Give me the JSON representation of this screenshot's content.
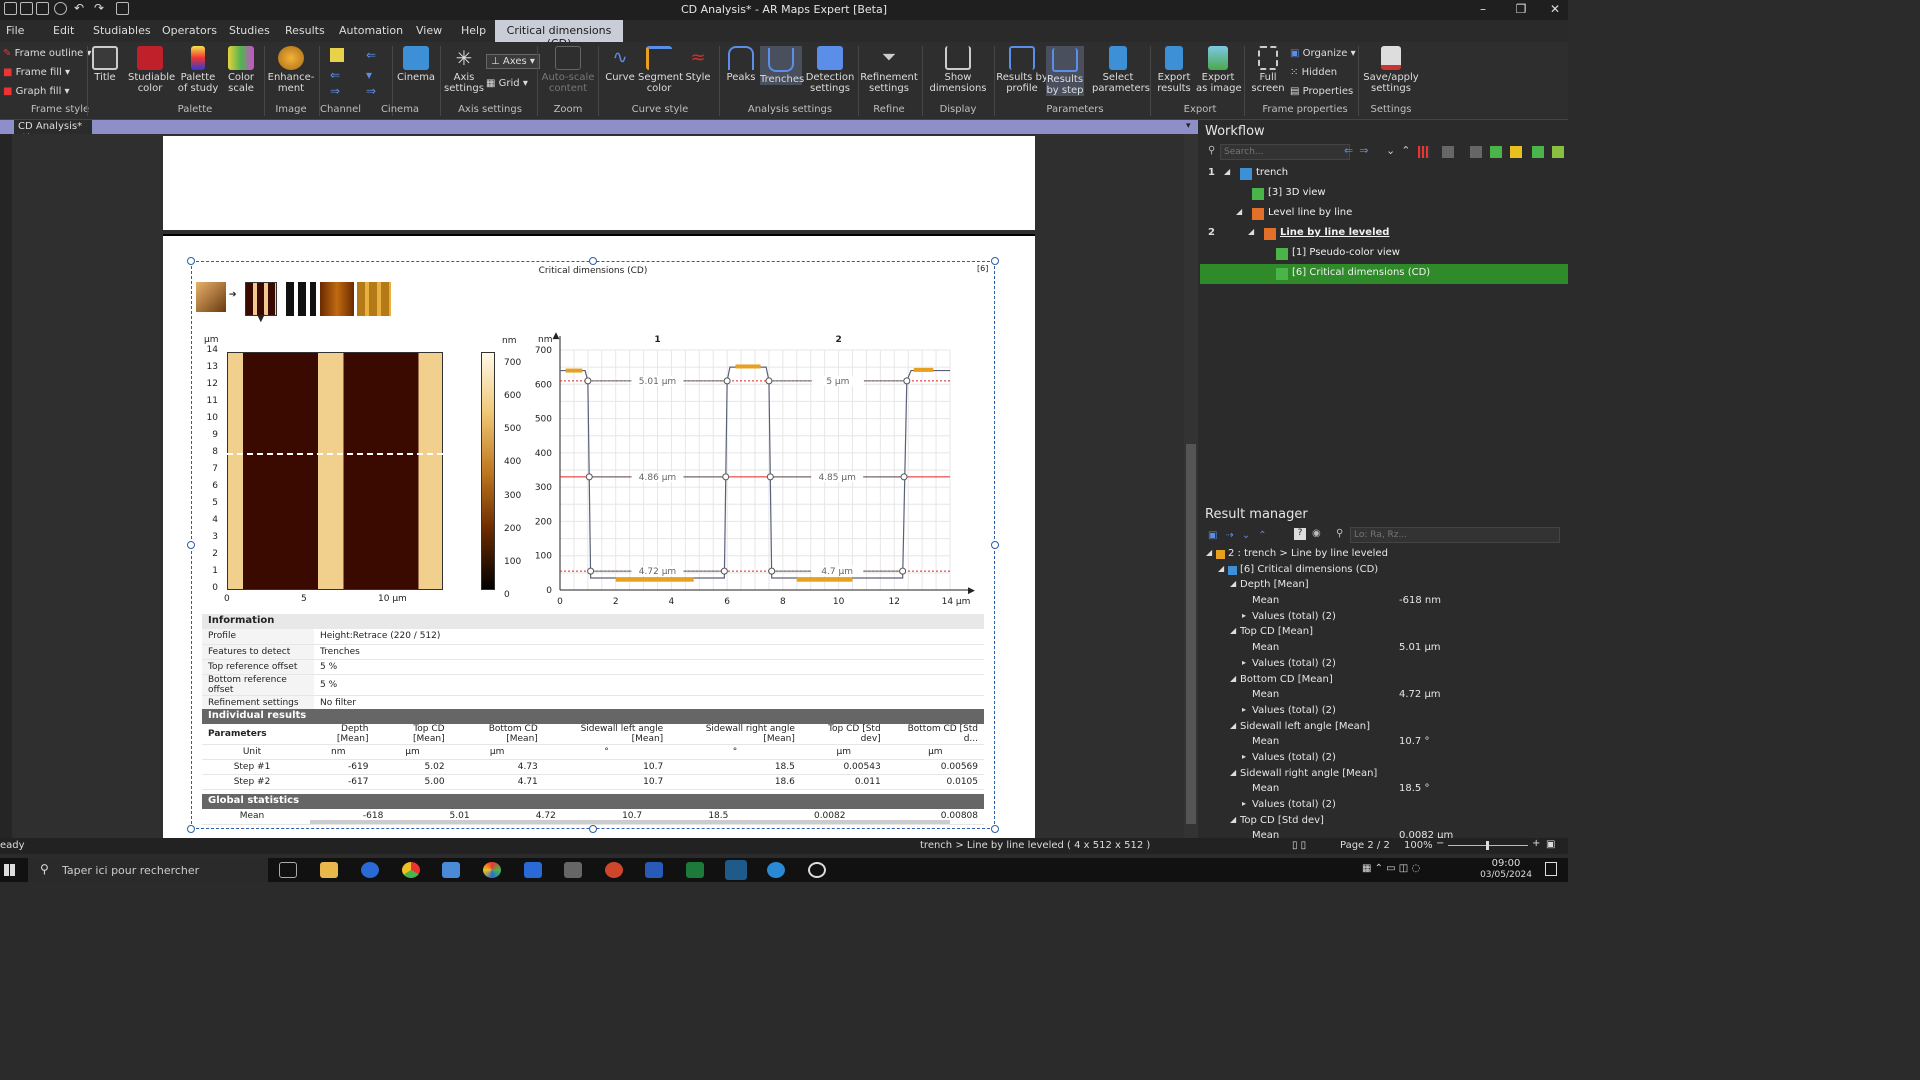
{
  "app": {
    "title": "CD Analysis* - AR Maps Expert [Beta]"
  },
  "menu": [
    "File",
    "Edit",
    "Studiables",
    "Operators",
    "Studies",
    "Results",
    "Automation",
    "View",
    "Help"
  ],
  "context_tab": "Critical dimensions (CD)",
  "ribbon": {
    "frame_style": [
      "Frame outline",
      "Frame fill",
      "Graph fill"
    ],
    "buttons": [
      {
        "id": "title",
        "label": "Title"
      },
      {
        "id": "studiable-color",
        "label": "Studiable\ncolor"
      },
      {
        "id": "palette-of-study",
        "label": "Palette\nof study"
      },
      {
        "id": "color-scale",
        "label": "Color\nscale"
      },
      {
        "id": "enhancement",
        "label": "Enhance-\nment"
      },
      {
        "id": "cinema",
        "label": "Cinema"
      },
      {
        "id": "axis-settings",
        "label": "Axis\nsettings"
      },
      {
        "id": "auto-scale",
        "label": "Auto-scale\ncontent"
      },
      {
        "id": "curve",
        "label": "Curve"
      },
      {
        "id": "segment-color",
        "label": "Segment\ncolor"
      },
      {
        "id": "style",
        "label": "Style"
      },
      {
        "id": "peaks",
        "label": "Peaks"
      },
      {
        "id": "trenches",
        "label": "Trenches"
      },
      {
        "id": "detection-settings",
        "label": "Detection\nsettings"
      },
      {
        "id": "refinement-settings",
        "label": "Refinement\nsettings"
      },
      {
        "id": "show-dimensions",
        "label": "Show\ndimensions"
      },
      {
        "id": "results-by-profile",
        "label": "Results by\nprofile"
      },
      {
        "id": "results-by-step",
        "label": "Results\nby step"
      },
      {
        "id": "select-parameters",
        "label": "Select\nparameters"
      },
      {
        "id": "export-results",
        "label": "Export\nresults"
      },
      {
        "id": "export-image",
        "label": "Export\nas image"
      },
      {
        "id": "full-screen",
        "label": "Full\nscreen"
      },
      {
        "id": "save-apply",
        "label": "Save/apply\nsettings"
      }
    ],
    "axes": "Axes",
    "grid": "Grid",
    "organize": "Organize",
    "hidden": "Hidden",
    "properties": "Properties",
    "groups": [
      "Frame style",
      "Palette",
      "Image",
      "Channel",
      "Cinema",
      "Axis settings",
      "Zoom",
      "Curve style",
      "Analysis settings",
      "Refine",
      "Display",
      "Parameters",
      "Export",
      "Frame properties",
      "Settings"
    ]
  },
  "doc_tab": "CD Analysis*",
  "study": {
    "title": "Critical dimensions (CD)",
    "index": "[6]",
    "image": {
      "unit": "µm",
      "y_ticks": [
        "14",
        "13",
        "12",
        "11",
        "10",
        "9",
        "8",
        "7",
        "6",
        "5",
        "4",
        "3",
        "2",
        "1",
        "0"
      ],
      "x_ticks": [
        "0",
        "5",
        "10 µm"
      ]
    },
    "colorbar": {
      "unit": "nm",
      "ticks": [
        "700",
        "600",
        "500",
        "400",
        "300",
        "200",
        "100",
        "0"
      ]
    },
    "profile": {
      "unit": "nm",
      "y_ticks": [
        "700",
        "600",
        "500",
        "400",
        "300",
        "200",
        "100",
        "0"
      ],
      "x_ticks": [
        "0",
        "2",
        "4",
        "6",
        "8",
        "10",
        "12",
        "14 µm"
      ],
      "trench_labels": [
        "1",
        "2"
      ],
      "dims": [
        "5.01 µm",
        "5 µm",
        "4.86 µm",
        "4.85 µm",
        "4.72 µm",
        "4.7 µm"
      ]
    },
    "info": {
      "title": "Information",
      "rows": [
        [
          "Profile",
          "Height:Retrace (220 / 512)"
        ],
        [
          "Features to detect",
          "Trenches"
        ],
        [
          "Top reference offset",
          "5 %"
        ],
        [
          "Bottom reference offset",
          "5 %"
        ],
        [
          "Refinement settings",
          "No filter"
        ]
      ]
    },
    "results": {
      "title": "Individual results",
      "headers": [
        "Parameters",
        "Depth [Mean]",
        "Top CD [Mean]",
        "Bottom CD [Mean]",
        "Sidewall left angle [Mean]",
        "Sidewall right angle [Mean]",
        "Top CD [Std dev]",
        "Bottom CD [Std d..."
      ],
      "rows": [
        [
          "Unit",
          "nm",
          "µm",
          "µm",
          "°",
          "°",
          "µm",
          "µm"
        ],
        [
          "Step #1",
          "-619",
          "5.02",
          "4.73",
          "10.7",
          "18.5",
          "0.00543",
          "0.00569"
        ],
        [
          "Step #2",
          "-617",
          "5.00",
          "4.71",
          "10.7",
          "18.6",
          "0.011",
          "0.0105"
        ]
      ]
    },
    "global": {
      "title": "Global statistics",
      "row": [
        "Mean",
        "-618",
        "5.01",
        "4.72",
        "10.7",
        "18.5",
        "0.0082",
        "0.00808"
      ]
    }
  },
  "workflow": {
    "title": "Workflow",
    "search_placeholder": "Search...",
    "items": [
      {
        "num": "1",
        "label": "trench",
        "indent": 0
      },
      {
        "num": "",
        "label": "[3] 3D view",
        "indent": 1
      },
      {
        "num": "",
        "label": "Level line by line",
        "indent": 1
      },
      {
        "num": "2",
        "label": "Line by line leveled",
        "indent": 2
      },
      {
        "num": "",
        "label": "[1] Pseudo-color view",
        "indent": 3
      },
      {
        "num": "",
        "label": "[6] Critical dimensions (CD)",
        "indent": 3
      }
    ]
  },
  "result_manager": {
    "title": "Result manager",
    "search_placeholder": "Lo: Ra, Rz...",
    "items": [
      {
        "label": "2 : trench > Line by line leveled",
        "value": "",
        "indent": 0
      },
      {
        "label": "[6] Critical dimensions (CD)",
        "value": "",
        "indent": 1
      },
      {
        "label": "Depth [Mean]",
        "value": "",
        "indent": 2
      },
      {
        "label": "Mean",
        "value": "-618 nm",
        "indent": 3
      },
      {
        "label": "Values (total) (2)",
        "value": "",
        "indent": 3
      },
      {
        "label": "Top CD [Mean]",
        "value": "",
        "indent": 2
      },
      {
        "label": "Mean",
        "value": "5.01 µm",
        "indent": 3
      },
      {
        "label": "Values (total) (2)",
        "value": "",
        "indent": 3
      },
      {
        "label": "Bottom CD [Mean]",
        "value": "",
        "indent": 2
      },
      {
        "label": "Mean",
        "value": "4.72 µm",
        "indent": 3
      },
      {
        "label": "Values (total) (2)",
        "value": "",
        "indent": 3
      },
      {
        "label": "Sidewall left angle [Mean]",
        "value": "",
        "indent": 2
      },
      {
        "label": "Mean",
        "value": "10.7 °",
        "indent": 3
      },
      {
        "label": "Values (total) (2)",
        "value": "",
        "indent": 3
      },
      {
        "label": "Sidewall right angle [Mean]",
        "value": "",
        "indent": 2
      },
      {
        "label": "Mean",
        "value": "18.5 °",
        "indent": 3
      },
      {
        "label": "Values (total) (2)",
        "value": "",
        "indent": 3
      },
      {
        "label": "Top CD [Std dev]",
        "value": "",
        "indent": 2
      },
      {
        "label": "Mean",
        "value": "0.0082 µm",
        "indent": 3
      }
    ]
  },
  "status": {
    "left": "eady",
    "path": "trench > Line by line leveled ( 4 x 512 x 512 )",
    "page": "Page 2 / 2",
    "zoom": "100%"
  },
  "taskbar": {
    "search": "Taper ici pour rechercher",
    "time": "09:00",
    "date": "03/05/2024"
  },
  "colors": {
    "accent": "#8e8fc8",
    "selected": "#3a8d2a",
    "profile_line": "#555a6a",
    "ref_line": "#e02020",
    "segment": "#e8a020"
  }
}
